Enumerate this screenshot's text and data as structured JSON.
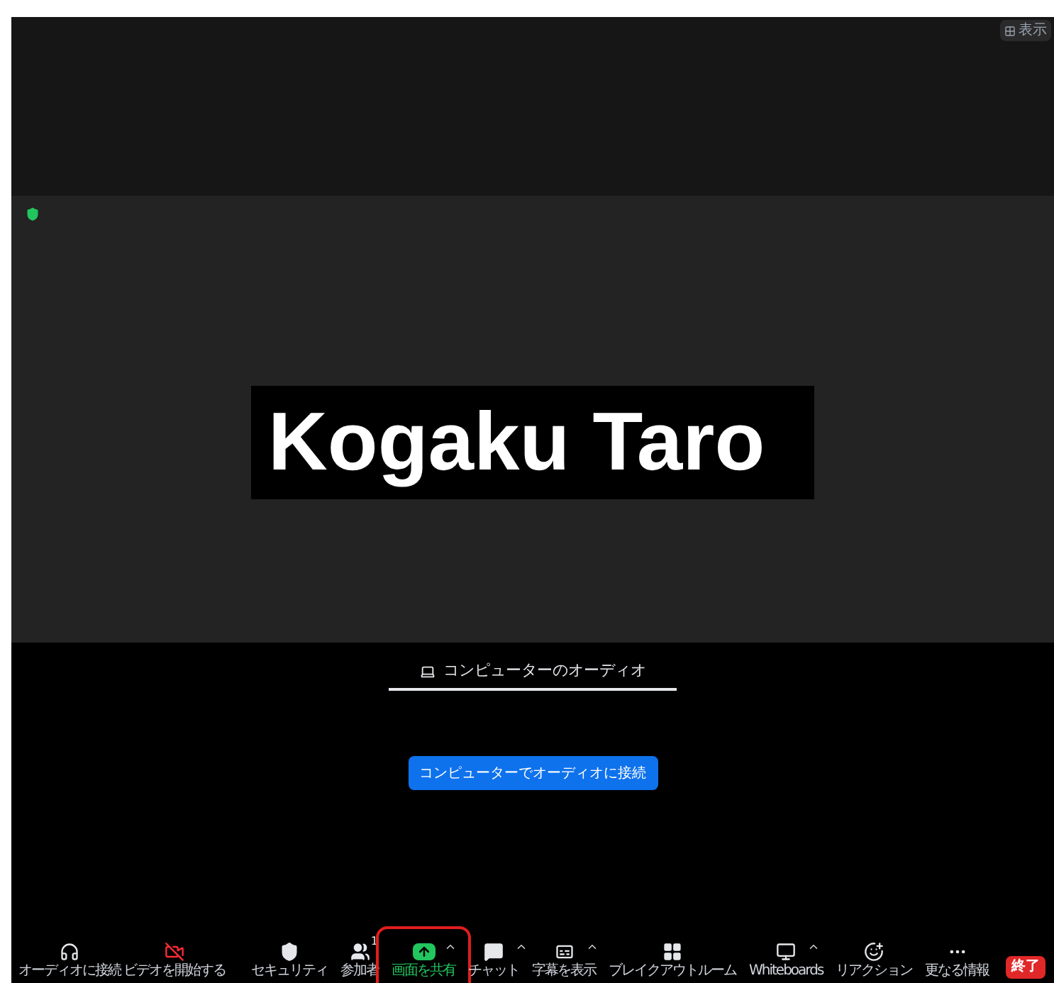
{
  "view_button": {
    "label": "表示"
  },
  "meeting": {
    "encrypted": true,
    "participant_name": "Kogaku Taro"
  },
  "audio_panel": {
    "tabs": [
      {
        "label": "コンピューターのオーディオ",
        "selected": true
      }
    ],
    "connect_button": "コンピューターでオーディオに接続"
  },
  "toolbar": {
    "left": [
      {
        "kind": "audio",
        "label": "オーディオに接続",
        "caret": false,
        "selected": false,
        "highlighted": false
      },
      {
        "kind": "video",
        "label": "ビデオを開始する",
        "caret": false,
        "selected": false,
        "highlighted": false
      }
    ],
    "center": [
      {
        "kind": "security",
        "label": "セキュリティ",
        "caret": false,
        "selected": false,
        "highlighted": false
      },
      {
        "kind": "participants",
        "label": "参加者",
        "badge": "1",
        "caret": false,
        "selected": false,
        "highlighted": false
      },
      {
        "kind": "share",
        "label": "画面を共有",
        "caret": true,
        "selected": true,
        "highlighted": true
      },
      {
        "kind": "chat",
        "label": "チャット",
        "caret": true,
        "selected": false,
        "highlighted": false
      },
      {
        "kind": "captions",
        "label": "字幕を表示",
        "caret": true,
        "selected": false,
        "highlighted": false
      },
      {
        "kind": "breakout",
        "label": "ブレイクアウトルーム",
        "caret": false,
        "selected": false,
        "highlighted": false
      },
      {
        "kind": "whiteboard",
        "label": "Whiteboards",
        "caret": true,
        "selected": false,
        "highlighted": false
      },
      {
        "kind": "reactions",
        "label": "リアクション",
        "caret": false,
        "selected": false,
        "highlighted": false
      },
      {
        "kind": "more",
        "label": "更なる情報",
        "caret": false,
        "selected": false,
        "highlighted": false
      }
    ],
    "end_button": "終了"
  }
}
